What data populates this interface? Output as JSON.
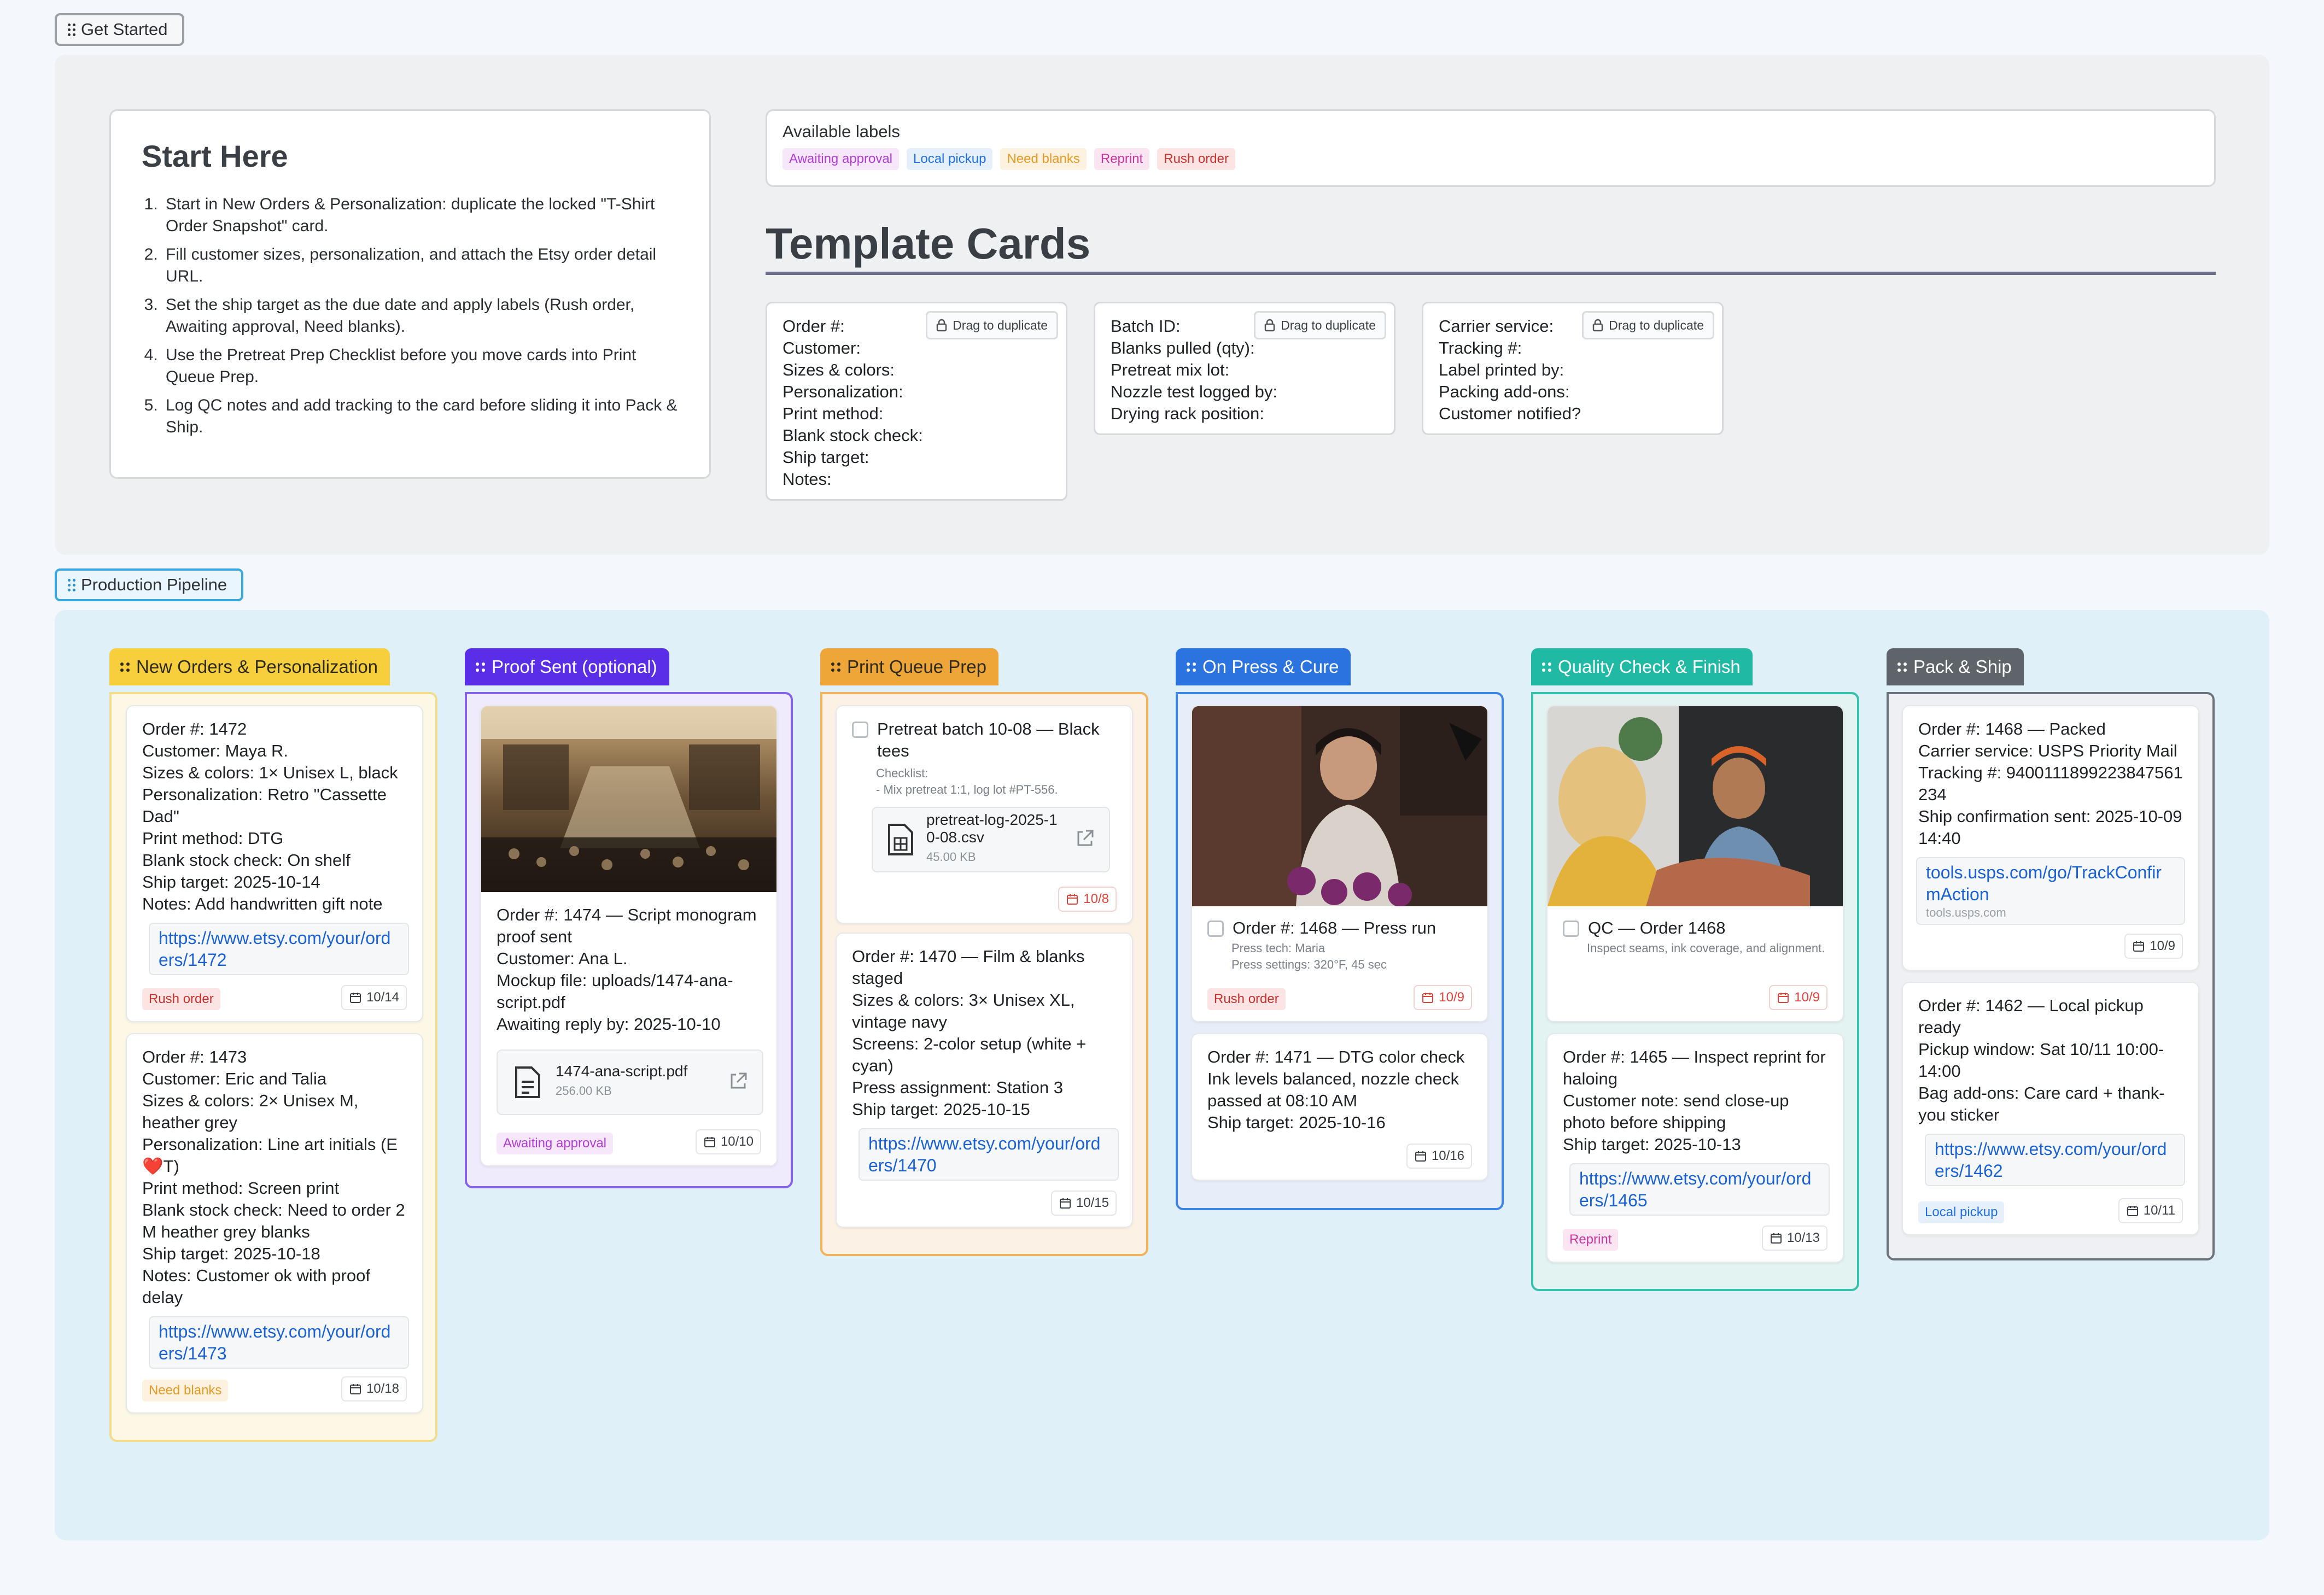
{
  "sections": {
    "get_started": "Get Started",
    "pipeline": "Production Pipeline"
  },
  "start_here": {
    "title": "Start Here",
    "steps": [
      "Start in New Orders & Personalization: duplicate the locked \"T-Shirt Order Snapshot\" card.",
      "Fill customer sizes, personalization, and attach the Etsy order detail URL.",
      "Set the ship target as the due date and apply labels (Rush order, Awaiting approval, Need blanks).",
      "Use the Pretreat Prep Checklist before you move cards into Print Queue Prep.",
      "Log QC notes and add tracking to the card before sliding it into Pack & Ship."
    ]
  },
  "labels": {
    "title": "Available labels",
    "items": [
      {
        "text": "Awaiting approval",
        "fg": "#b23bd6",
        "bg": "#f6e7fb"
      },
      {
        "text": "Local pickup",
        "fg": "#1f6fe0",
        "bg": "#e6f0fd"
      },
      {
        "text": "Need blanks",
        "fg": "#e89a23",
        "bg": "#fdf1df"
      },
      {
        "text": "Reprint",
        "fg": "#c8379e",
        "bg": "#fbe5f3"
      },
      {
        "text": "Rush order",
        "fg": "#c8322c",
        "bg": "#fbe4e3"
      }
    ]
  },
  "templates": {
    "heading": "Template Cards",
    "drag_label": "Drag to duplicate",
    "cards": [
      {
        "lines": [
          "Order #:",
          "Customer:",
          "Sizes & colors:",
          "Personalization:",
          "Print method:",
          "Blank stock check:",
          "Ship target:",
          "Notes:"
        ]
      },
      {
        "lines": [
          "Batch ID:",
          "Blanks pulled (qty):",
          "Pretreat mix lot:",
          "Nozzle test logged by:",
          "Drying rack position:"
        ]
      },
      {
        "lines": [
          "Carrier service:",
          "Tracking #:",
          "Label printed by:",
          "Packing add-ons:",
          "Customer notified?"
        ]
      }
    ]
  },
  "columns": [
    {
      "title": "New Orders & Personalization",
      "color": "#f7cf3d",
      "body_bg": "#fdf8e6",
      "border": "#f3dc8e",
      "text": "#2d2a1f"
    },
    {
      "title": "Proof Sent (optional)",
      "color": "#5a2ee6",
      "body_bg": "#efeafc",
      "border": "#8463ea",
      "text": "#ffffff"
    },
    {
      "title": "Print Queue Prep",
      "color": "#efa638",
      "body_bg": "#fbf1e5",
      "border": "#efb45c",
      "text": "#2d2a1f"
    },
    {
      "title": "On Press & Cure",
      "color": "#2b74e0",
      "body_bg": "#e7eef9",
      "border": "#3d82e4",
      "text": "#ffffff"
    },
    {
      "title": "Quality Check & Finish",
      "color": "#20b9a3",
      "body_bg": "#e2f3f1",
      "border": "#37c0ab",
      "text": "#ffffff"
    },
    {
      "title": "Pack & Ship",
      "color": "#5f646b",
      "body_bg": "#eef0f3",
      "border": "#6d737a",
      "text": "#ffffff"
    }
  ],
  "cards": {
    "o1472": {
      "lines": [
        "Order #: 1472",
        "Customer: Maya R.",
        "Sizes & colors: 1× Unisex L, black",
        "Personalization: Retro \"Cassette Dad\"",
        "Print method: DTG",
        "Blank stock check: On shelf",
        "Ship target: 2025-10-14",
        "Notes: Add handwritten gift note"
      ],
      "link": "https://www.etsy.com/your/orders/1472",
      "label": "Rush order",
      "date": "10/14"
    },
    "o1473": {
      "lines": [
        "Order #: 1473",
        "Customer: Eric and Talia",
        "Sizes & colors: 2× Unisex M, heather grey",
        "Personalization: Line art initials (E❤️T)",
        "Print method: Screen print",
        "Blank stock check: Need to order 2 M heather grey blanks",
        "Ship target: 2025-10-18",
        "Notes: Customer ok with proof delay"
      ],
      "link": "https://www.etsy.com/your/orders/1473",
      "label": "Need blanks",
      "date": "10/18"
    },
    "o1474": {
      "lines": [
        "Order #: 1474 — Script monogram proof sent",
        "Customer: Ana L.",
        "Mockup file: uploads/1474-ana-script.pdf",
        "Awaiting reply by: 2025-10-10"
      ],
      "file_name": "1474-ana-script.pdf",
      "file_size": "256.00 KB",
      "label": "Awaiting approval",
      "date": "10/10"
    },
    "pretreat": {
      "title": "Pretreat batch 10-08 — Black tees",
      "checklist_label": "Checklist:",
      "checklist_item": "- Mix pretreat 1:1, log lot #PT-556.",
      "file_name": "pretreat-log-2025-10-08.csv",
      "file_size": "45.00 KB",
      "date": "10/8"
    },
    "o1470": {
      "lines": [
        "Order #: 1470 — Film & blanks staged",
        "Sizes & colors: 3× Unisex XL, vintage navy",
        "Screens: 2-color setup (white + cyan)",
        "Press assignment: Station 3",
        "Ship target: 2025-10-15"
      ],
      "link": "https://www.etsy.com/your/orders/1470",
      "date": "10/15"
    },
    "o1468press": {
      "title": "Order #: 1468 — Press run",
      "sub1": "Press tech: Maria",
      "sub2": "Press settings: 320°F, 45 sec",
      "label": "Rush order",
      "date": "10/9"
    },
    "o1471": {
      "lines": [
        "Order #: 1471 — DTG color check",
        "Ink levels balanced, nozzle check passed at 08:10 AM",
        "Ship target: 2025-10-16"
      ],
      "date": "10/16"
    },
    "qc1468": {
      "title": "QC — Order 1468",
      "sub": "Inspect seams, ink coverage, and alignment.",
      "date": "10/9"
    },
    "o1465": {
      "lines": [
        "Order #: 1465 — Inspect reprint for haloing",
        "Customer note: send close-up photo before shipping",
        "Ship target: 2025-10-13"
      ],
      "link": "https://www.etsy.com/your/orders/1465",
      "label": "Reprint",
      "date": "10/13"
    },
    "o1468packed": {
      "lines": [
        "Order #: 1468 — Packed",
        "Carrier service: USPS Priority Mail",
        "Tracking #: 9400111899223847561234",
        "Ship confirmation sent: 2025-10-09 14:40"
      ],
      "link": "tools.usps.com/go/TrackConfirmAction",
      "link_domain": "tools.usps.com",
      "date": "10/9"
    },
    "o1462": {
      "lines": [
        "Order #: 1462 — Local pickup ready",
        "Pickup window: Sat 10/11 10:00-14:00",
        "Bag add-ons: Care card + thank-you sticker"
      ],
      "link": "https://www.etsy.com/your/orders/1462",
      "label": "Local pickup",
      "date": "10/11"
    }
  }
}
